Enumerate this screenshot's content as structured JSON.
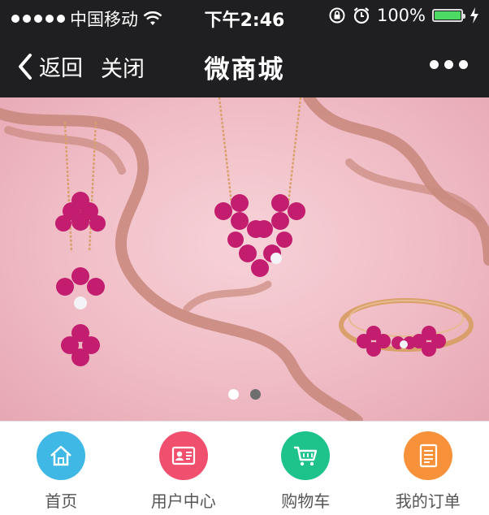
{
  "status_bar": {
    "carrier": "中国移动",
    "time": "下午2:46",
    "battery_percent": "100%",
    "battery_level": 1.0,
    "icons": [
      "signal-dots-icon",
      "wifi-icon",
      "rotation-lock-icon",
      "alarm-icon",
      "battery-icon",
      "charging-icon"
    ]
  },
  "nav": {
    "back_label": "返回",
    "close_label": "关闭",
    "title": "微商城",
    "more_icon": "more-dots-icon"
  },
  "banner": {
    "slide_count": 2,
    "active_slide": 1,
    "colors": {
      "background": "#f0bcc5",
      "ribbon": "#c98a7e",
      "gem": "#c21d6e",
      "gold": "#d9a06b"
    }
  },
  "tabbar": {
    "items": [
      {
        "label": "首页",
        "icon": "home-icon",
        "color": "#3fb8e6"
      },
      {
        "label": "用户中心",
        "icon": "user-card-icon",
        "color": "#f0506e"
      },
      {
        "label": "购物车",
        "icon": "shopping-cart-icon",
        "color": "#1ec28b"
      },
      {
        "label": "我的订单",
        "icon": "order-list-icon",
        "color": "#f7923a"
      }
    ]
  }
}
